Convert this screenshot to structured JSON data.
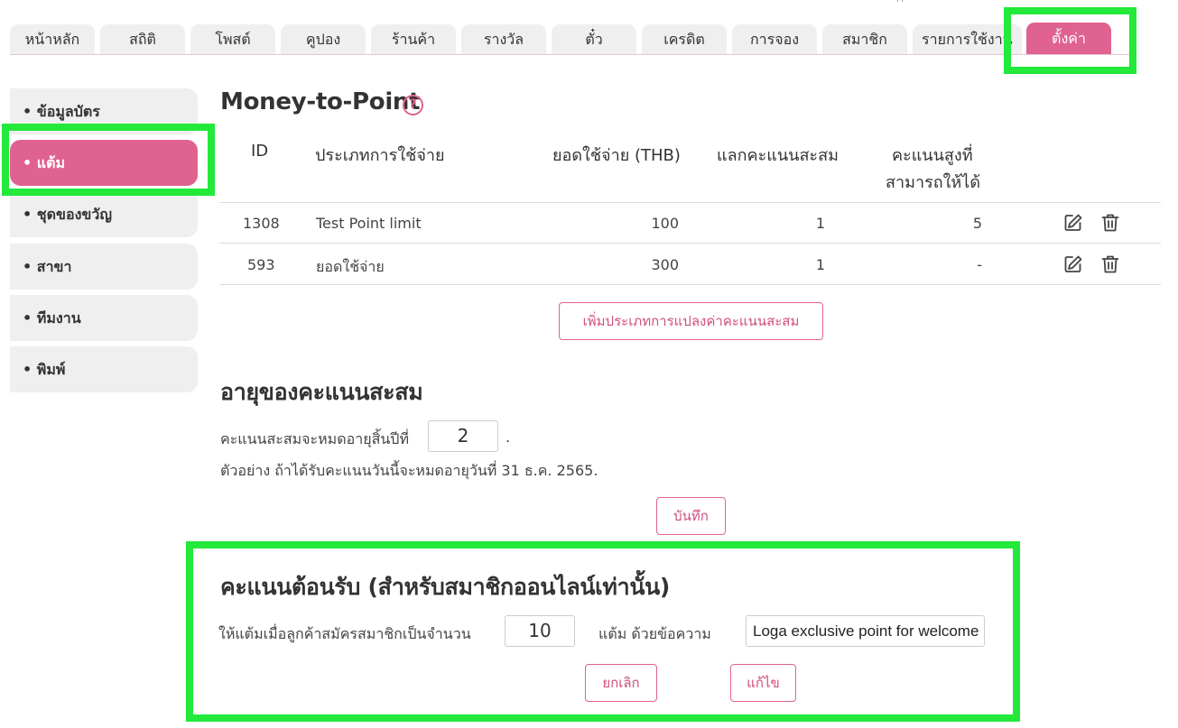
{
  "tabs": [
    {
      "label": "หน้าหลัก"
    },
    {
      "label": "สถิติ"
    },
    {
      "label": "โพสต์"
    },
    {
      "label": "คูปอง"
    },
    {
      "label": "ร้านค้า"
    },
    {
      "label": "รางวัล"
    },
    {
      "label": "ตั๋ว"
    },
    {
      "label": "เครดิต"
    },
    {
      "label": "การจอง"
    },
    {
      "label": "สมาชิก"
    },
    {
      "label": "รายการใช้งาน"
    },
    {
      "label": "ตั้งค่า",
      "active": true
    }
  ],
  "sidebar": {
    "items": [
      {
        "label": "• ข้อมูลบัตร"
      },
      {
        "label": "• แต้ม",
        "active": true
      },
      {
        "label": "• ชุดของขวัญ"
      },
      {
        "label": "• สาขา"
      },
      {
        "label": "• ทีมงาน"
      },
      {
        "label": "• พิมพ์"
      }
    ]
  },
  "money_to_point": {
    "title": "Money-to-Point",
    "help_glyph": "?",
    "columns": {
      "id": "ID",
      "type": "ประเภทการใช้จ่าย",
      "amount": "ยอดใช้จ่าย (THB)",
      "exchange": "แลกคะแนนสะสม",
      "max_line1": "คะแนนสูงที่",
      "max_line2": "สามารถให้ได้"
    },
    "rows": [
      {
        "id": "1308",
        "type": "Test Point limit",
        "amount": "100",
        "exchange": "1",
        "max": "5"
      },
      {
        "id": "593",
        "type": "ยอดใช้จ่าย",
        "amount": "300",
        "exchange": "1",
        "max": "-"
      }
    ],
    "add_button": "เพิ่มประเภทการแปลงค่าคะแนนสะสม"
  },
  "expiry": {
    "title": "อายุของคะแนนสะสม",
    "label": "คะแนนสะสมจะหมดอายุสิ้นปีที่",
    "value": "2",
    "suffix": ".",
    "example": "ตัวอย่าง ถ้าได้รับคะแนนวันนี้จะหมดอายุวันที่ 31 ธ.ค. 2565.",
    "save_button": "บันทึก"
  },
  "welcome": {
    "title": "คะแนนต้อนรับ (สำหรับสมาชิกออนไลน์เท่านั้น)",
    "label": "ให้แต้มเมื่อลูกค้าสมัครสมาชิกเป็นจำนวน",
    "points": "10",
    "message_label": "แต้ม ด้วยข้อความ",
    "message_value": "Loga exclusive point for welcome",
    "cancel_button": "ยกเลิก",
    "edit_button": "แก้ไข"
  },
  "colors": {
    "accent": "#e06291",
    "highlight": "#22e93a",
    "tab_bg": "#efefef"
  }
}
